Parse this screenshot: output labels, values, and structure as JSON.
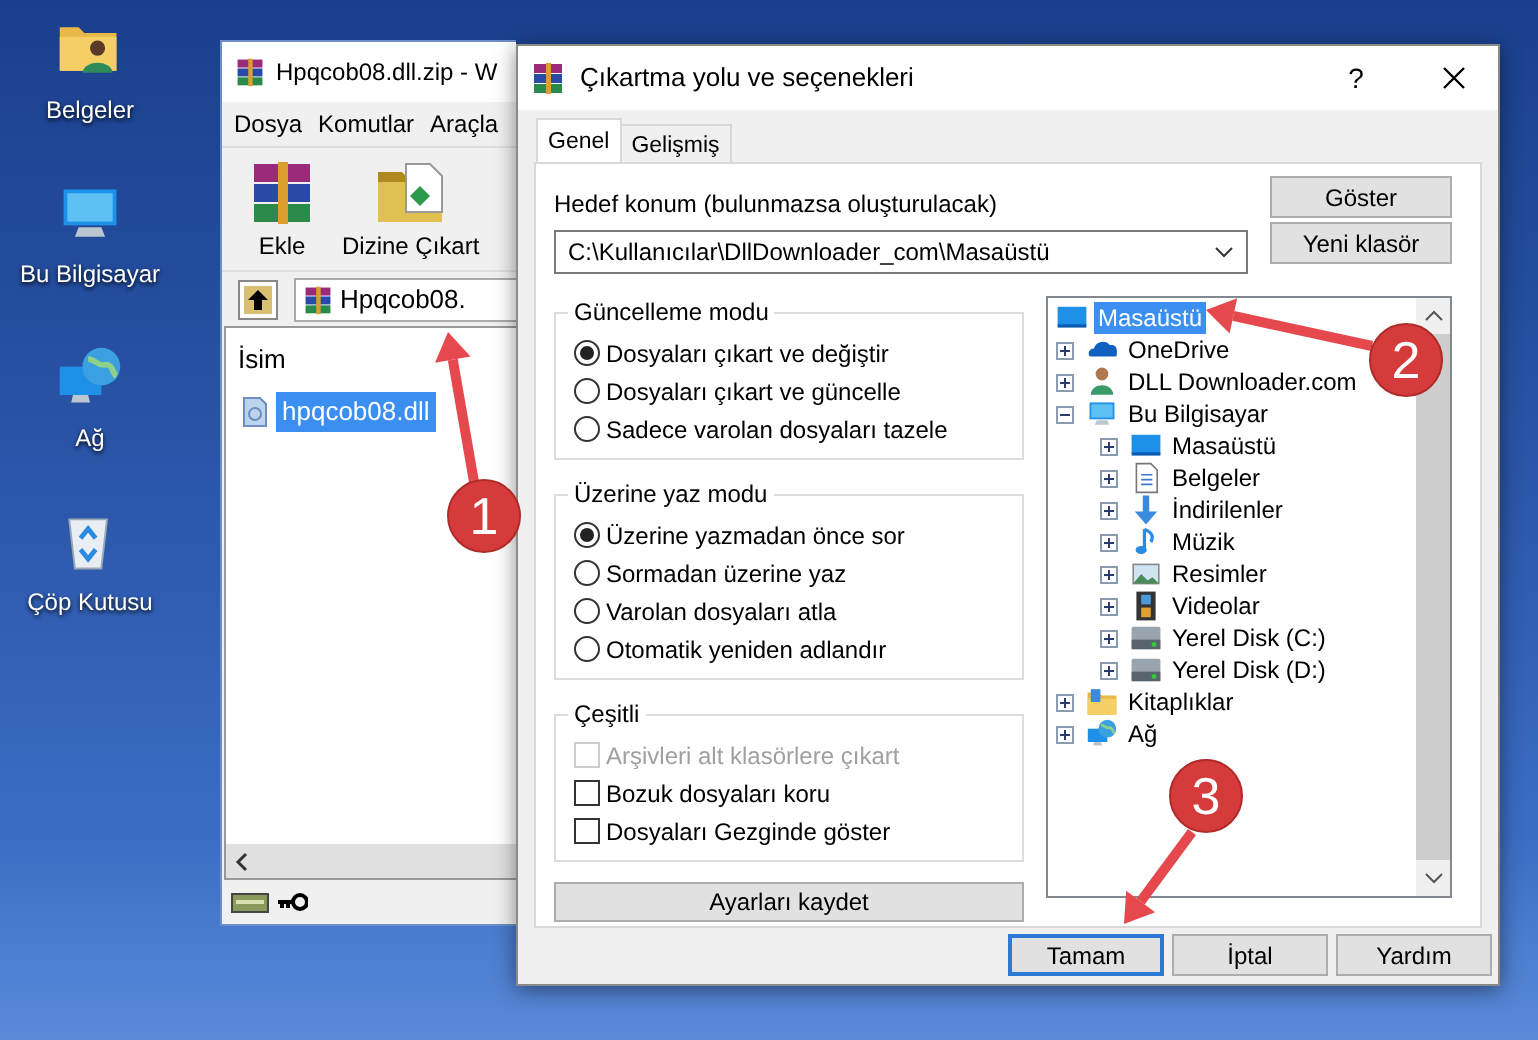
{
  "desktop_icons": [
    {
      "label": "Belgeler",
      "kind": "folder"
    },
    {
      "label": "Bu Bilgisayar",
      "kind": "computer"
    },
    {
      "label": "Ağ",
      "kind": "network"
    },
    {
      "label": "Çöp Kutusu",
      "kind": "recycle"
    }
  ],
  "archiver_window": {
    "title": "Hpqcob08.dll.zip - W",
    "menu": [
      "Dosya",
      "Komutlar",
      "Araçla"
    ],
    "toolbar": [
      {
        "label": "Ekle",
        "kind": "archive"
      },
      {
        "label": "Dizine Çıkart",
        "kind": "extract"
      }
    ],
    "address": "Hpqcob08.",
    "columns": [
      "İsim"
    ],
    "files": [
      {
        "name": "hpqcob08.dll",
        "selected": true
      }
    ]
  },
  "dialog": {
    "title": "Çıkartma yolu ve seçenekleri",
    "help": "?",
    "tabs": [
      {
        "label": "Genel",
        "selected": true
      },
      {
        "label": "Gelişmiş",
        "selected": false
      }
    ],
    "destination": {
      "label": "Hedef konum (bulunmazsa oluşturulacak)",
      "value": "C:\\Kullanıcılar\\DllDownloader_com\\Masaüstü"
    },
    "side_buttons": [
      "Göster",
      "Yeni klasör"
    ],
    "groups": [
      {
        "title": "Güncelleme modu",
        "kind": "radio",
        "options": [
          {
            "label": "Dosyaları çıkart ve değiştir",
            "selected": true
          },
          {
            "label": "Dosyaları çıkart ve güncelle",
            "selected": false
          },
          {
            "label": "Sadece varolan dosyaları tazele",
            "selected": false
          }
        ]
      },
      {
        "title": "Üzerine yaz modu",
        "kind": "radio",
        "options": [
          {
            "label": "Üzerine yazmadan önce sor",
            "selected": true
          },
          {
            "label": "Sormadan üzerine yaz",
            "selected": false
          },
          {
            "label": "Varolan dosyaları atla",
            "selected": false
          },
          {
            "label": "Otomatik yeniden adlandır",
            "selected": false
          }
        ]
      },
      {
        "title": "Çeşitli",
        "kind": "checkbox",
        "options": [
          {
            "label": "Arşivleri alt klasörlere çıkart",
            "checked": false,
            "disabled": true
          },
          {
            "label": "Bozuk dosyaları koru",
            "checked": false,
            "disabled": false
          },
          {
            "label": "Dosyaları Gezginde göster",
            "checked": false,
            "disabled": false
          }
        ]
      }
    ],
    "save_button": "Ayarları kaydet",
    "folder_tree": {
      "label": "Masaüstü",
      "kind": "desktop",
      "selected": true,
      "children": [
        {
          "label": "OneDrive",
          "kind": "cloud",
          "selected": false,
          "expanded": false
        },
        {
          "label": "DLL Downloader.com",
          "kind": "user",
          "selected": false,
          "expanded": false
        },
        {
          "label": "Bu Bilgisayar",
          "kind": "computer",
          "selected": false,
          "expanded": true,
          "children": [
            {
              "label": "Masaüstü",
              "kind": "desktop",
              "selected": false,
              "expanded": false
            },
            {
              "label": "Belgeler",
              "kind": "document",
              "selected": false,
              "expanded": false
            },
            {
              "label": "İndirilenler",
              "kind": "download",
              "selected": false,
              "expanded": false
            },
            {
              "label": "Müzik",
              "kind": "music",
              "selected": false,
              "expanded": false
            },
            {
              "label": "Resimler",
              "kind": "pictures",
              "selected": false,
              "expanded": false
            },
            {
              "label": "Videolar",
              "kind": "videos",
              "selected": false,
              "expanded": false
            },
            {
              "label": "Yerel Disk (C:)",
              "kind": "disk",
              "selected": false,
              "expanded": false
            },
            {
              "label": "Yerel Disk (D:)",
              "kind": "disk",
              "selected": false,
              "expanded": false
            }
          ]
        },
        {
          "label": "Kitaplıklar",
          "kind": "library",
          "selected": false,
          "expanded": false
        },
        {
          "label": "Ağ",
          "kind": "network",
          "selected": false,
          "expanded": false
        }
      ]
    },
    "buttons": [
      {
        "label": "Tamam",
        "default": true
      },
      {
        "label": "İptal",
        "default": false
      },
      {
        "label": "Yardım",
        "default": false
      }
    ]
  },
  "annotations": [
    {
      "number": "1"
    },
    {
      "number": "2"
    },
    {
      "number": "3"
    }
  ]
}
